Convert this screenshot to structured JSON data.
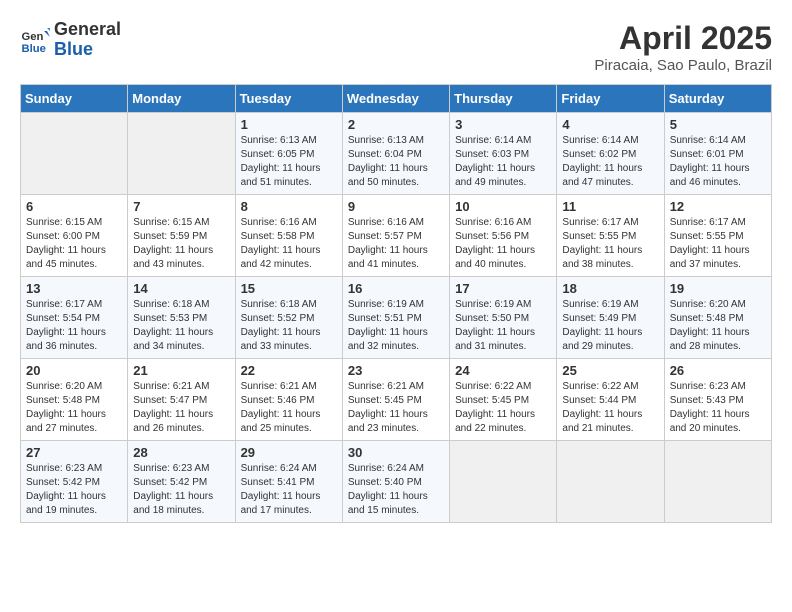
{
  "logo": {
    "line1": "General",
    "line2": "Blue"
  },
  "title": "April 2025",
  "subtitle": "Piracaia, Sao Paulo, Brazil",
  "days_header": [
    "Sunday",
    "Monday",
    "Tuesday",
    "Wednesday",
    "Thursday",
    "Friday",
    "Saturday"
  ],
  "weeks": [
    [
      {
        "num": "",
        "info": ""
      },
      {
        "num": "",
        "info": ""
      },
      {
        "num": "1",
        "info": "Sunrise: 6:13 AM\nSunset: 6:05 PM\nDaylight: 11 hours and 51 minutes."
      },
      {
        "num": "2",
        "info": "Sunrise: 6:13 AM\nSunset: 6:04 PM\nDaylight: 11 hours and 50 minutes."
      },
      {
        "num": "3",
        "info": "Sunrise: 6:14 AM\nSunset: 6:03 PM\nDaylight: 11 hours and 49 minutes."
      },
      {
        "num": "4",
        "info": "Sunrise: 6:14 AM\nSunset: 6:02 PM\nDaylight: 11 hours and 47 minutes."
      },
      {
        "num": "5",
        "info": "Sunrise: 6:14 AM\nSunset: 6:01 PM\nDaylight: 11 hours and 46 minutes."
      }
    ],
    [
      {
        "num": "6",
        "info": "Sunrise: 6:15 AM\nSunset: 6:00 PM\nDaylight: 11 hours and 45 minutes."
      },
      {
        "num": "7",
        "info": "Sunrise: 6:15 AM\nSunset: 5:59 PM\nDaylight: 11 hours and 43 minutes."
      },
      {
        "num": "8",
        "info": "Sunrise: 6:16 AM\nSunset: 5:58 PM\nDaylight: 11 hours and 42 minutes."
      },
      {
        "num": "9",
        "info": "Sunrise: 6:16 AM\nSunset: 5:57 PM\nDaylight: 11 hours and 41 minutes."
      },
      {
        "num": "10",
        "info": "Sunrise: 6:16 AM\nSunset: 5:56 PM\nDaylight: 11 hours and 40 minutes."
      },
      {
        "num": "11",
        "info": "Sunrise: 6:17 AM\nSunset: 5:55 PM\nDaylight: 11 hours and 38 minutes."
      },
      {
        "num": "12",
        "info": "Sunrise: 6:17 AM\nSunset: 5:55 PM\nDaylight: 11 hours and 37 minutes."
      }
    ],
    [
      {
        "num": "13",
        "info": "Sunrise: 6:17 AM\nSunset: 5:54 PM\nDaylight: 11 hours and 36 minutes."
      },
      {
        "num": "14",
        "info": "Sunrise: 6:18 AM\nSunset: 5:53 PM\nDaylight: 11 hours and 34 minutes."
      },
      {
        "num": "15",
        "info": "Sunrise: 6:18 AM\nSunset: 5:52 PM\nDaylight: 11 hours and 33 minutes."
      },
      {
        "num": "16",
        "info": "Sunrise: 6:19 AM\nSunset: 5:51 PM\nDaylight: 11 hours and 32 minutes."
      },
      {
        "num": "17",
        "info": "Sunrise: 6:19 AM\nSunset: 5:50 PM\nDaylight: 11 hours and 31 minutes."
      },
      {
        "num": "18",
        "info": "Sunrise: 6:19 AM\nSunset: 5:49 PM\nDaylight: 11 hours and 29 minutes."
      },
      {
        "num": "19",
        "info": "Sunrise: 6:20 AM\nSunset: 5:48 PM\nDaylight: 11 hours and 28 minutes."
      }
    ],
    [
      {
        "num": "20",
        "info": "Sunrise: 6:20 AM\nSunset: 5:48 PM\nDaylight: 11 hours and 27 minutes."
      },
      {
        "num": "21",
        "info": "Sunrise: 6:21 AM\nSunset: 5:47 PM\nDaylight: 11 hours and 26 minutes."
      },
      {
        "num": "22",
        "info": "Sunrise: 6:21 AM\nSunset: 5:46 PM\nDaylight: 11 hours and 25 minutes."
      },
      {
        "num": "23",
        "info": "Sunrise: 6:21 AM\nSunset: 5:45 PM\nDaylight: 11 hours and 23 minutes."
      },
      {
        "num": "24",
        "info": "Sunrise: 6:22 AM\nSunset: 5:45 PM\nDaylight: 11 hours and 22 minutes."
      },
      {
        "num": "25",
        "info": "Sunrise: 6:22 AM\nSunset: 5:44 PM\nDaylight: 11 hours and 21 minutes."
      },
      {
        "num": "26",
        "info": "Sunrise: 6:23 AM\nSunset: 5:43 PM\nDaylight: 11 hours and 20 minutes."
      }
    ],
    [
      {
        "num": "27",
        "info": "Sunrise: 6:23 AM\nSunset: 5:42 PM\nDaylight: 11 hours and 19 minutes."
      },
      {
        "num": "28",
        "info": "Sunrise: 6:23 AM\nSunset: 5:42 PM\nDaylight: 11 hours and 18 minutes."
      },
      {
        "num": "29",
        "info": "Sunrise: 6:24 AM\nSunset: 5:41 PM\nDaylight: 11 hours and 17 minutes."
      },
      {
        "num": "30",
        "info": "Sunrise: 6:24 AM\nSunset: 5:40 PM\nDaylight: 11 hours and 15 minutes."
      },
      {
        "num": "",
        "info": ""
      },
      {
        "num": "",
        "info": ""
      },
      {
        "num": "",
        "info": ""
      }
    ]
  ]
}
